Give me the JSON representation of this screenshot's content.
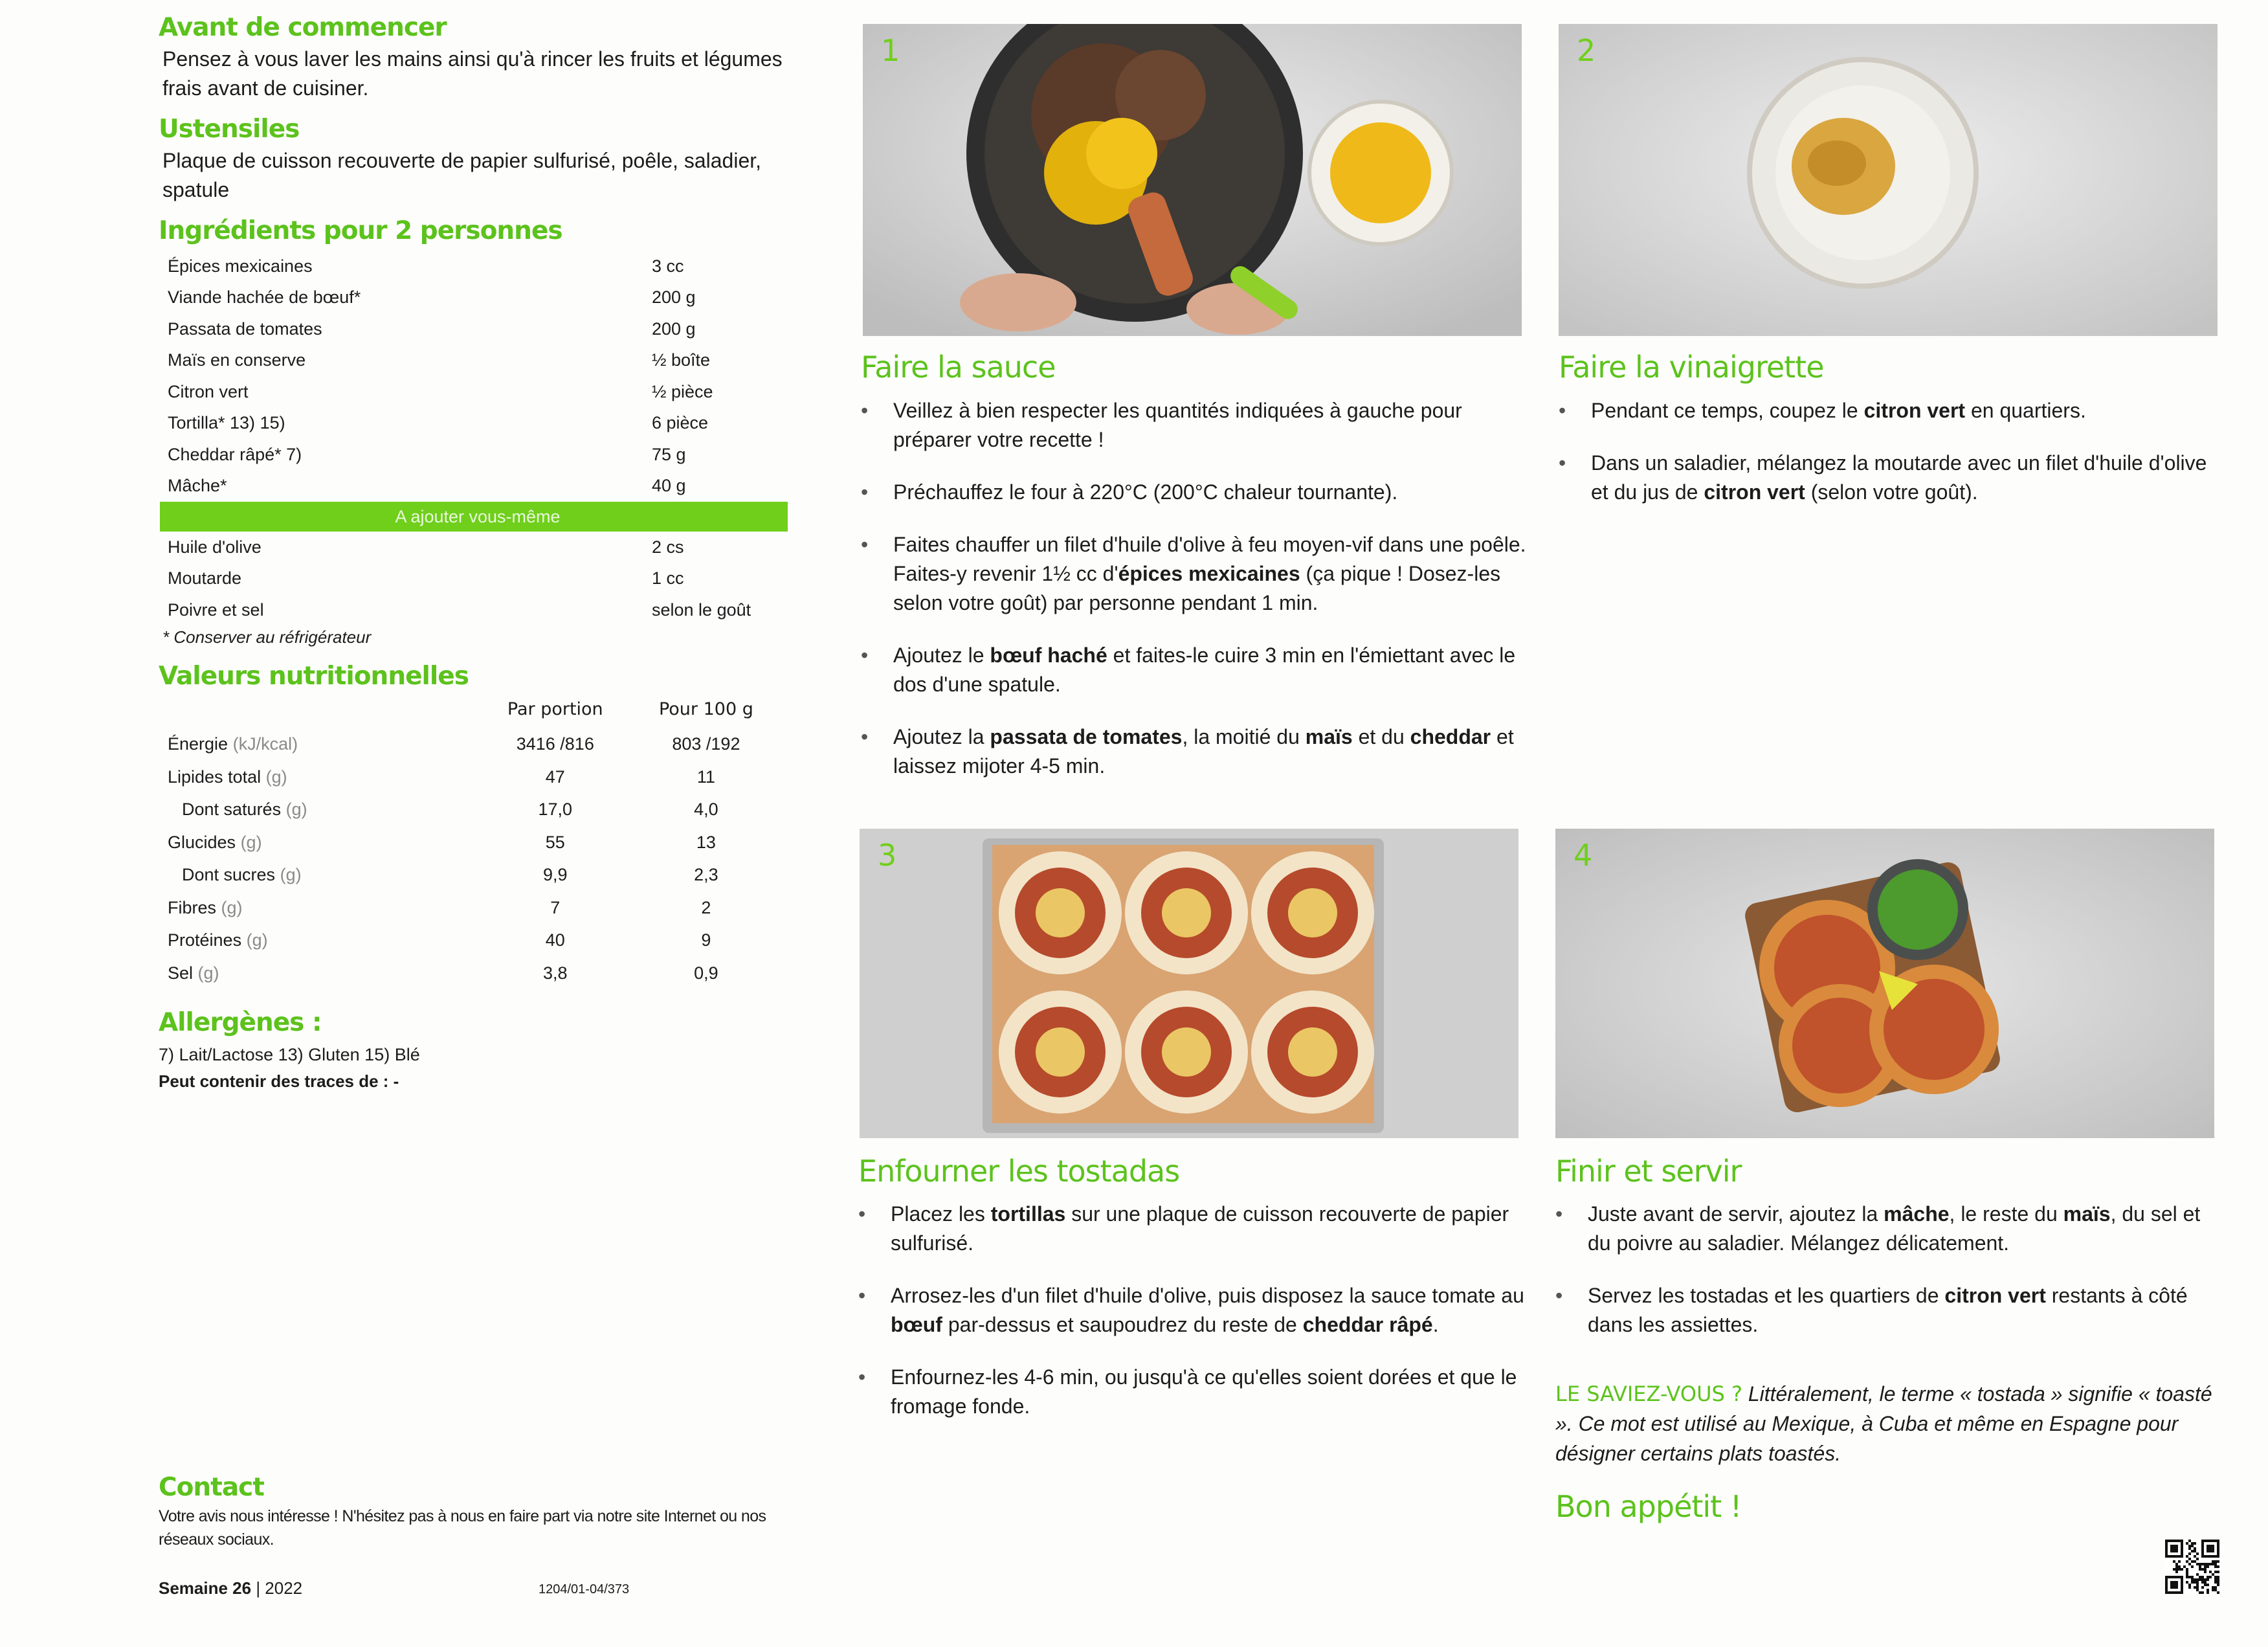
{
  "intro": {
    "title": "Avant de commencer",
    "text": "Pensez à vous laver les mains ainsi qu'à rincer les fruits et légumes frais avant de cuisiner."
  },
  "utensils": {
    "title": "Ustensiles",
    "text": "Plaque de cuisson recouverte de papier sulfurisé, poêle, saladier, spatule"
  },
  "ingredients": {
    "title": "Ingrédients pour 2 personnes",
    "items": [
      {
        "name": "Épices mexicaines",
        "qty": "3 cc"
      },
      {
        "name": "Viande hachée de bœuf*",
        "qty": "200 g"
      },
      {
        "name": "Passata de tomates",
        "qty": "200 g"
      },
      {
        "name": "Maïs en conserve",
        "qty": "½ boîte"
      },
      {
        "name": "Citron vert",
        "qty": "½ pièce"
      },
      {
        "name": "Tortilla* 13) 15)",
        "qty": "6 pièce"
      },
      {
        "name": "Cheddar râpé* 7)",
        "qty": "75 g"
      },
      {
        "name": "Mâche*",
        "qty": "40 g"
      }
    ],
    "add_yourself_label": "A ajouter vous-même",
    "extra": [
      {
        "name": "Huile d'olive",
        "qty": "2 cs"
      },
      {
        "name": "Moutarde",
        "qty": "1 cc"
      },
      {
        "name": "Poivre et sel",
        "qty": "selon le goût"
      }
    ],
    "note": "* Conserver au réfrigérateur"
  },
  "nutrition": {
    "title": "Valeurs nutritionnelles",
    "col_portion": "Par portion",
    "col_100g": "Pour 100 g",
    "rows": [
      {
        "label": "Énergie",
        "unit": "(kJ/kcal)",
        "portion": "3416 /816",
        "per100": "803 /192",
        "indent": false
      },
      {
        "label": "Lipides total",
        "unit": "(g)",
        "portion": "47",
        "per100": "11",
        "indent": false
      },
      {
        "label": "Dont saturés",
        "unit": "(g)",
        "portion": "17,0",
        "per100": "4,0",
        "indent": true
      },
      {
        "label": "Glucides",
        "unit": "(g)",
        "portion": "55",
        "per100": "13",
        "indent": false
      },
      {
        "label": "Dont sucres",
        "unit": "(g)",
        "portion": "9,9",
        "per100": "2,3",
        "indent": true
      },
      {
        "label": "Fibres",
        "unit": "(g)",
        "portion": "7",
        "per100": "2",
        "indent": false
      },
      {
        "label": "Protéines",
        "unit": "(g)",
        "portion": "40",
        "per100": "9",
        "indent": false
      },
      {
        "label": "Sel",
        "unit": "(g)",
        "portion": "3,8",
        "per100": "0,9",
        "indent": false
      }
    ]
  },
  "allergens": {
    "title": "Allergènes :",
    "list": "7) Lait/Lactose 13) Gluten 15) Blé",
    "traces": "Peut contenir des traces de : -"
  },
  "contact": {
    "title": "Contact",
    "text": "Votre avis nous intéresse ! N'hésitez pas à nous en faire part via notre site Internet ou nos réseaux sociaux."
  },
  "footer": {
    "week": "Semaine 26",
    "year": "2022",
    "code": "1204/01-04/373"
  },
  "steps": [
    {
      "number": "1",
      "title": "Faire la sauce",
      "bullets": [
        "Veillez à bien respecter les quantités indiquées à gauche pour préparer votre recette !",
        "Préchauffez le four à 220°C (200°C chaleur tournante).",
        "Faites chauffer un filet d'huile d'olive à feu moyen-vif dans une poêle. Faites-y revenir 1½ cc d'<b>épices mexicaines</b> (ça pique ! Dosez-les selon votre goût) par personne pendant 1 min.",
        "Ajoutez le <b>bœuf haché</b> et faites-le cuire 3 min en l'émiettant avec le dos d'une spatule.",
        "Ajoutez la <b>passata de tomates</b>, la moitié du <b>maïs</b> et du <b>cheddar</b> et laissez mijoter 4-5 min."
      ]
    },
    {
      "number": "2",
      "title": "Faire la vinaigrette",
      "bullets": [
        "Pendant ce temps, coupez le <b>citron vert</b> en quartiers.",
        "Dans un saladier, mélangez la moutarde avec un filet d'huile d'olive et du jus de <b>citron vert</b> (selon votre goût)."
      ]
    },
    {
      "number": "3",
      "title": "Enfourner les tostadas",
      "bullets": [
        "Placez les <b>tortillas</b> sur une plaque de cuisson recouverte de papier sulfurisé.",
        "Arrosez-les d'un filet d'huile d'olive, puis disposez la sauce tomate au <b>bœuf</b> par-dessus et saupoudrez du reste de <b>cheddar râpé</b>.",
        "Enfournez-les 4-6 min, ou jusqu'à ce qu'elles soient dorées et que le fromage fonde."
      ]
    },
    {
      "number": "4",
      "title": "Finir et servir",
      "bullets": [
        "Juste avant de servir, ajoutez la <b>mâche</b>, le reste du <b>maïs</b>, du sel et du poivre au saladier. Mélangez délicatement.",
        "Servez les tostadas et les quartiers de <b>citron vert</b> restants à côté dans les assiettes."
      ]
    }
  ],
  "tip": {
    "label": "LE SAVIEZ-VOUS ?",
    "text": "Littéralement, le terme « tostada » signifie « toasté ». Ce mot est utilisé au Mexique, à Cuba et même en Espagne pour désigner certains plats toastés."
  },
  "closing": "Bon appétit !",
  "colors": {
    "accent": "#6fcf1b",
    "text": "#1c1c1c"
  }
}
